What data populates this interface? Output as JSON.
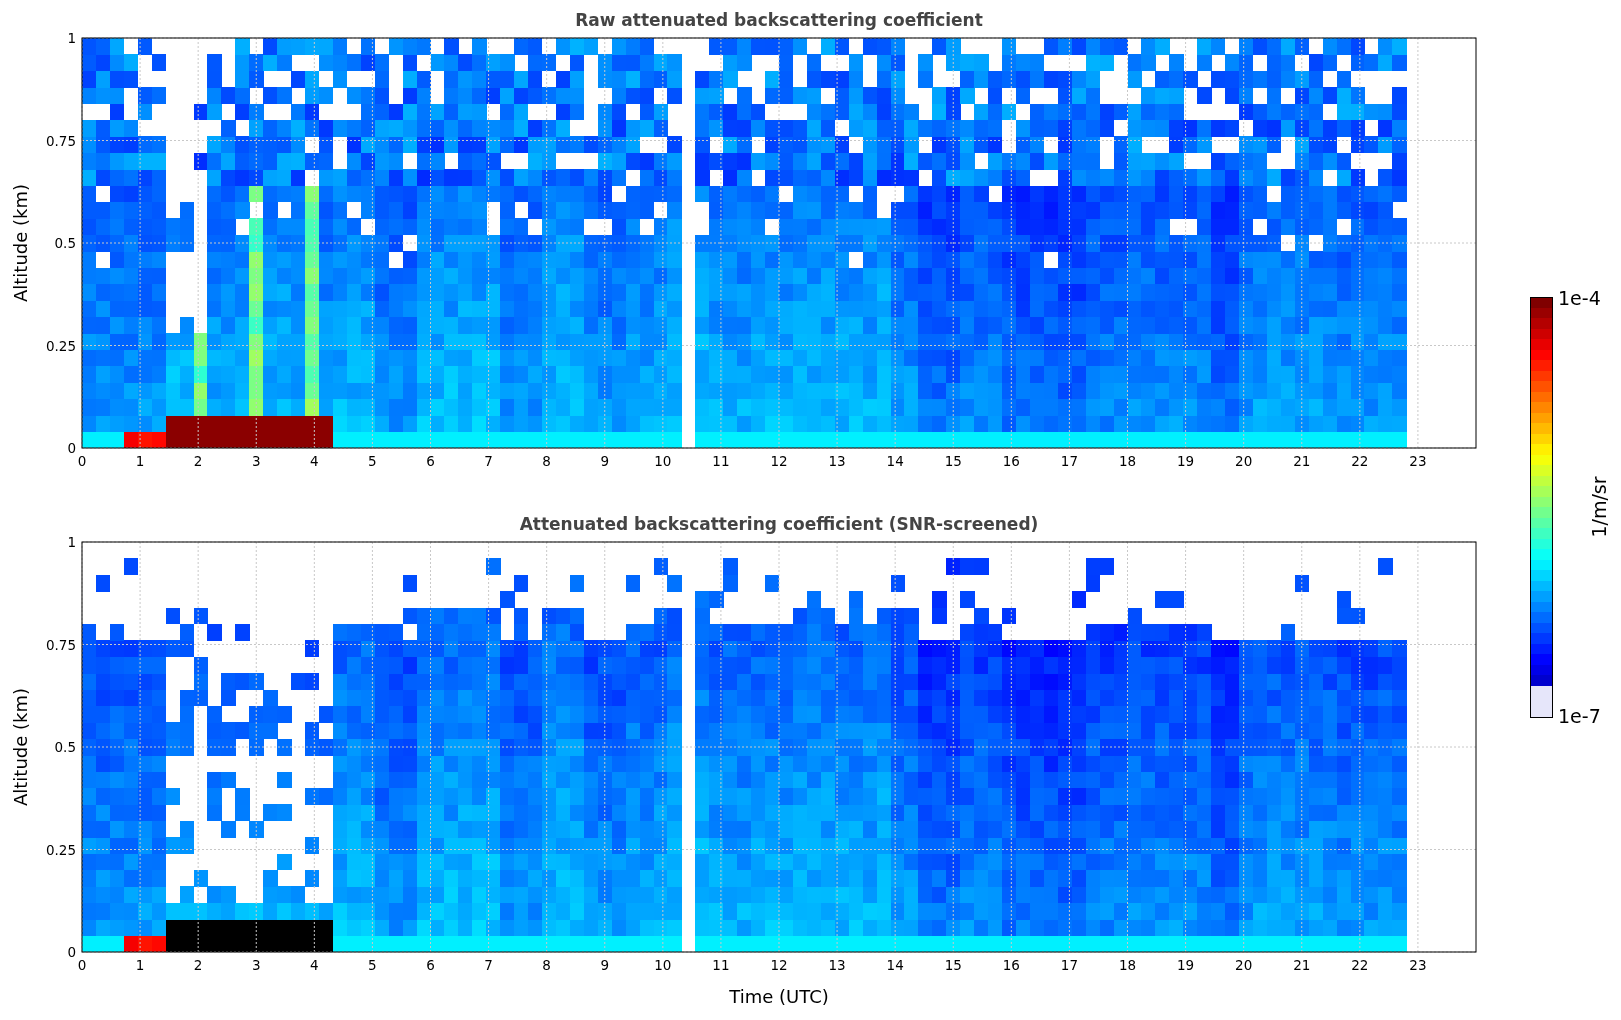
{
  "panels": [
    {
      "kind": "raw",
      "title": "Raw attenuated backscattering coefficient",
      "ylabel": "Altitude (km)",
      "yticks": [
        "1",
        "0.75",
        "0.5",
        "0.25",
        "0"
      ],
      "xticks": [
        "0",
        "1",
        "2",
        "3",
        "4",
        "5",
        "6",
        "7",
        "8",
        "9",
        "10",
        "11",
        "12",
        "13",
        "14",
        "15",
        "16",
        "17",
        "18",
        "19",
        "20",
        "21",
        "22",
        "23"
      ]
    },
    {
      "kind": "screened",
      "title": "Attenuated backscattering coefficient (SNR-screened)",
      "ylabel": "Altitude (km)",
      "yticks": [
        "1",
        "0.75",
        "0.5",
        "0.25",
        "0"
      ],
      "xticks": [
        "0",
        "1",
        "2",
        "3",
        "4",
        "5",
        "6",
        "7",
        "8",
        "9",
        "10",
        "11",
        "12",
        "13",
        "14",
        "15",
        "16",
        "17",
        "18",
        "19",
        "20",
        "21",
        "22",
        "23"
      ],
      "xlabel": "Time (UTC)"
    }
  ],
  "colorbar": {
    "max_label": "1e-4",
    "min_label": "1e-7",
    "unit": "1/m/sr"
  }
}
